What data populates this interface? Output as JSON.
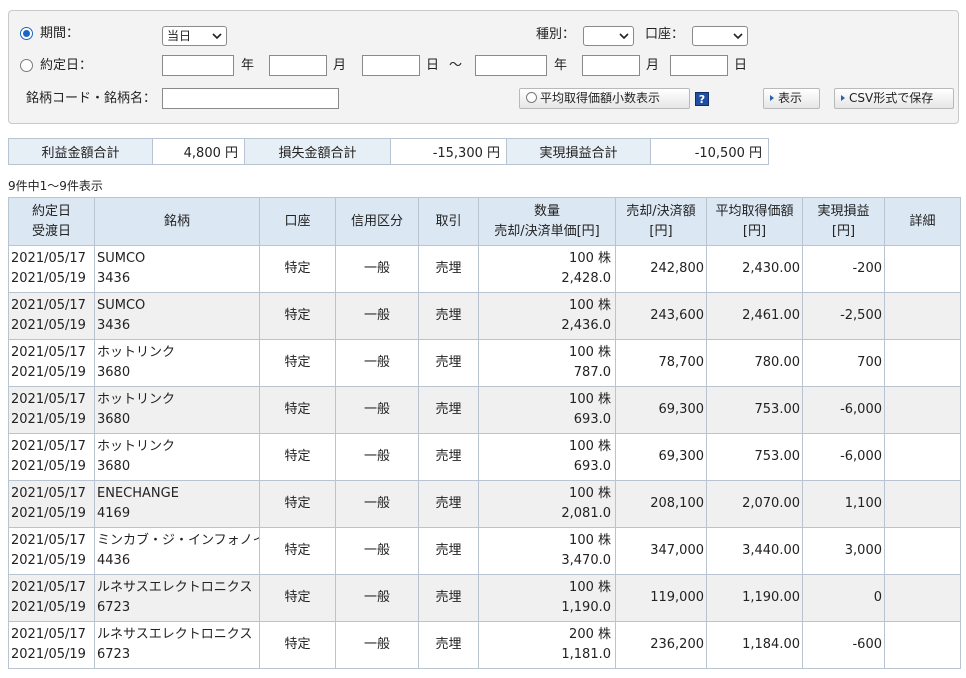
{
  "search": {
    "period_label": "期間：",
    "period_value": "当日",
    "contract_label": "約定日：",
    "year": "年",
    "month": "月",
    "day": "日",
    "tilde": "〜",
    "type_label": "種別：",
    "account_label": "口座：",
    "code_label": "銘柄コード・銘柄名：",
    "avg_decimal_label": "平均取得価額小数表示",
    "help": "?",
    "show_button": "表示",
    "csv_button": "CSV形式で保存"
  },
  "summary": {
    "profit_label": "利益金額合計",
    "profit_value": "4,800 円",
    "loss_label": "損失金額合計",
    "loss_value": "-15,300 円",
    "realized_label": "実現損益合計",
    "realized_value": "-10,500 円"
  },
  "count_text": "9件中1〜9件表示",
  "table": {
    "headers": {
      "date1": "約定日",
      "date2": "受渡日",
      "name": "銘柄",
      "account": "口座",
      "credit": "信用区分",
      "trade": "取引",
      "qty1": "数量",
      "qty2": "売却/決済単価[円]",
      "amt1": "売却/決済額",
      "amt2": "[円]",
      "avg1": "平均取得価額",
      "avg2": "[円]",
      "pl1": "実現損益",
      "pl2": "[円]",
      "detail": "詳細"
    },
    "rows": [
      {
        "contract_date": "2021/05/17",
        "delivery_date": "2021/05/19",
        "name": "SUMCO",
        "code": "3436",
        "account": "特定",
        "credit": "一般",
        "trade": "売埋",
        "quantity": "100 株",
        "price": "2,428.0",
        "amount": "242,800",
        "avg_price": "2,430.00",
        "pl": "-200"
      },
      {
        "contract_date": "2021/05/17",
        "delivery_date": "2021/05/19",
        "name": "SUMCO",
        "code": "3436",
        "account": "特定",
        "credit": "一般",
        "trade": "売埋",
        "quantity": "100 株",
        "price": "2,436.0",
        "amount": "243,600",
        "avg_price": "2,461.00",
        "pl": "-2,500"
      },
      {
        "contract_date": "2021/05/17",
        "delivery_date": "2021/05/19",
        "name": "ホットリンク",
        "code": "3680",
        "account": "特定",
        "credit": "一般",
        "trade": "売埋",
        "quantity": "100 株",
        "price": "787.0",
        "amount": "78,700",
        "avg_price": "780.00",
        "pl": "700"
      },
      {
        "contract_date": "2021/05/17",
        "delivery_date": "2021/05/19",
        "name": "ホットリンク",
        "code": "3680",
        "account": "特定",
        "credit": "一般",
        "trade": "売埋",
        "quantity": "100 株",
        "price": "693.0",
        "amount": "69,300",
        "avg_price": "753.00",
        "pl": "-6,000"
      },
      {
        "contract_date": "2021/05/17",
        "delivery_date": "2021/05/19",
        "name": "ホットリンク",
        "code": "3680",
        "account": "特定",
        "credit": "一般",
        "trade": "売埋",
        "quantity": "100 株",
        "price": "693.0",
        "amount": "69,300",
        "avg_price": "753.00",
        "pl": "-6,000"
      },
      {
        "contract_date": "2021/05/17",
        "delivery_date": "2021/05/19",
        "name": "ENECHANGE",
        "code": "4169",
        "account": "特定",
        "credit": "一般",
        "trade": "売埋",
        "quantity": "100 株",
        "price": "2,081.0",
        "amount": "208,100",
        "avg_price": "2,070.00",
        "pl": "1,100"
      },
      {
        "contract_date": "2021/05/17",
        "delivery_date": "2021/05/19",
        "name": "ミンカブ・ジ・インフォノイト",
        "code": "4436",
        "account": "特定",
        "credit": "一般",
        "trade": "売埋",
        "quantity": "100 株",
        "price": "3,470.0",
        "amount": "347,000",
        "avg_price": "3,440.00",
        "pl": "3,000"
      },
      {
        "contract_date": "2021/05/17",
        "delivery_date": "2021/05/19",
        "name": "ルネサスエレクトロニクス",
        "code": "6723",
        "account": "特定",
        "credit": "一般",
        "trade": "売埋",
        "quantity": "100 株",
        "price": "1,190.0",
        "amount": "119,000",
        "avg_price": "1,190.00",
        "pl": "0"
      },
      {
        "contract_date": "2021/05/17",
        "delivery_date": "2021/05/19",
        "name": "ルネサスエレクトロニクス",
        "code": "6723",
        "account": "特定",
        "credit": "一般",
        "trade": "売埋",
        "quantity": "200 株",
        "price": "1,181.0",
        "amount": "236,200",
        "avg_price": "1,184.00",
        "pl": "-600"
      }
    ]
  }
}
